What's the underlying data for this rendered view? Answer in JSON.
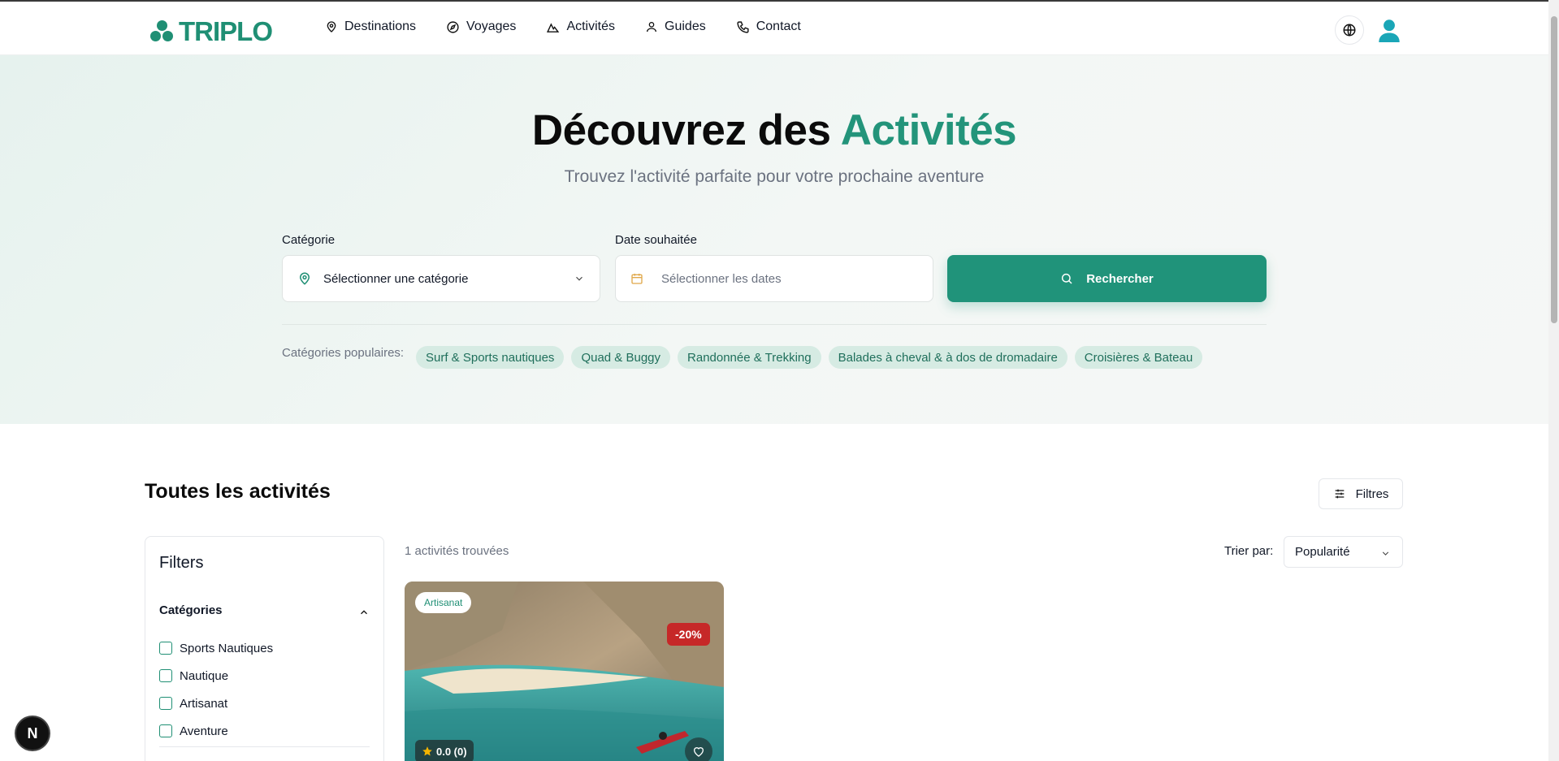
{
  "brand": {
    "name": "TRIPLO",
    "color": "#1f8f74"
  },
  "nav": [
    {
      "label": "Destinations",
      "icon": "map-pin-icon"
    },
    {
      "label": "Voyages",
      "icon": "compass-icon"
    },
    {
      "label": "Activités",
      "icon": "mountain-icon"
    },
    {
      "label": "Guides",
      "icon": "person-icon"
    },
    {
      "label": "Contact",
      "icon": "phone-icon"
    }
  ],
  "hero": {
    "title_main": "Découvrez des ",
    "title_accent": "Activités",
    "subtitle": "Trouvez l'activité parfaite pour votre prochaine aventure",
    "category_label": "Catégorie",
    "category_value": "Sélectionner une catégorie",
    "date_label": "Date souhaitée",
    "date_placeholder": "Sélectionner les dates",
    "search_label": "Rechercher",
    "popular_label": "Catégories populaires:",
    "popular": [
      "Surf & Sports nautiques",
      "Quad & Buggy",
      "Randonnée & Trekking",
      "Balades à cheval & à dos de dromadaire",
      "Croisières & Bateau"
    ]
  },
  "section": {
    "title": "Toutes les activités",
    "filters_button": "Filtres",
    "results_count": "1 activités trouvées",
    "sort_label": "Trier par:",
    "sort_value": "Popularité"
  },
  "sidebar": {
    "title": "Filters",
    "categories_heading": "Catégories",
    "categories": [
      "Sports Nautiques",
      "Nautique",
      "Artisanat",
      "Aventure"
    ]
  },
  "card": {
    "category": "Artisanat",
    "discount": "-20%",
    "rating": "0.0 (0)"
  },
  "dev_badge": "N",
  "colors": {
    "accent": "#23947a",
    "chip_bg": "#d6ebe3",
    "discount": "#c62828"
  }
}
